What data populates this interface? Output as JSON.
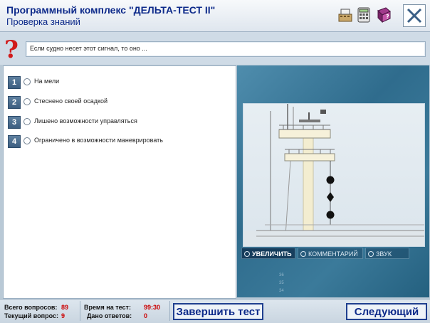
{
  "header": {
    "title": "Программный комплекс \"ДЕЛЬТА-ТЕСТ II\"",
    "subtitle": "Проверка знаний",
    "icons": [
      "cash-register-icon",
      "calculator-icon",
      "help-book-icon",
      "close-icon"
    ]
  },
  "question": {
    "text": "Если судно несет этот сигнал, то оно ..."
  },
  "answers": [
    {
      "number": "1",
      "text": "На мели"
    },
    {
      "number": "2",
      "text": "Стеснено своей осадкой"
    },
    {
      "number": "3",
      "text": "Лишено возможности управляться"
    },
    {
      "number": "4",
      "text": "Ограничено в возможности маневрировать"
    }
  ],
  "media": {
    "buttons": [
      "УВЕЛИЧИТЬ",
      "КОММЕНТАРИЙ",
      "ЗВУК"
    ],
    "scale": [
      "36",
      "35",
      "34"
    ]
  },
  "footer": {
    "total_label": "Всего вопросов:",
    "total_value": "89",
    "current_label": "Текущий вопрос:",
    "current_value": "9",
    "time_label": "Время на тест:",
    "time_value": "99:30",
    "answered_label": "Дано ответов:",
    "answered_value": "0",
    "finish_button": "Завершить тест",
    "next_button": "Следующий"
  },
  "colors": {
    "title": "#0d2a8a",
    "counter_value": "#cc0000",
    "media_panel": "#2f6c8d"
  }
}
